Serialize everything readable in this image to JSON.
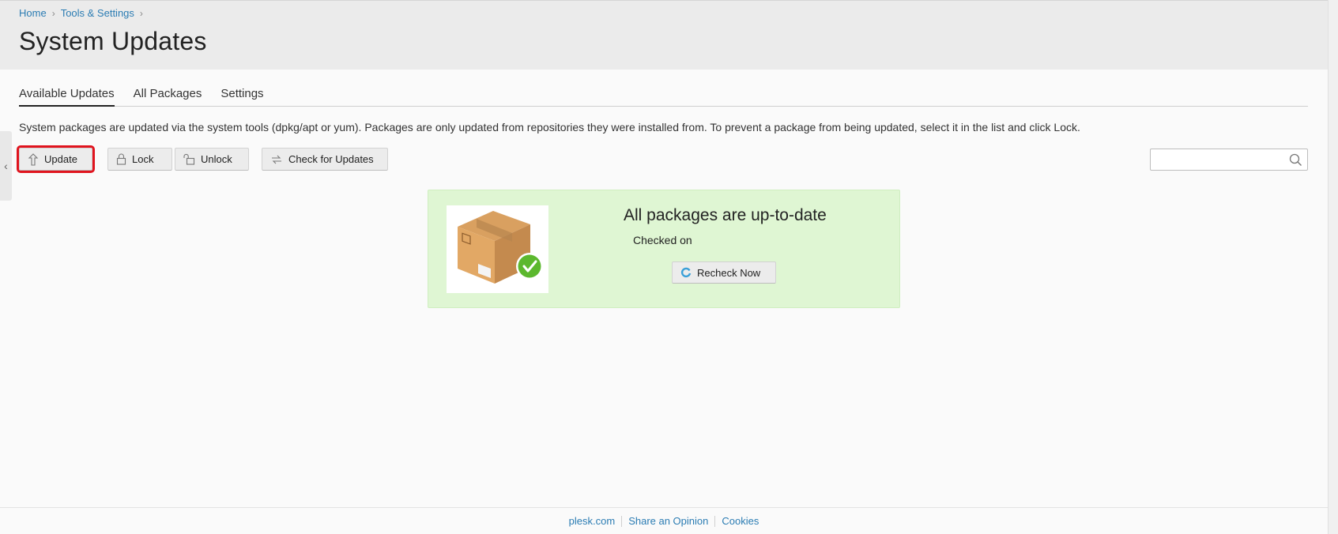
{
  "breadcrumb": {
    "items": [
      "Home",
      "Tools & Settings"
    ]
  },
  "page": {
    "title": "System Updates"
  },
  "tabs": [
    {
      "label": "Available Updates",
      "active": true
    },
    {
      "label": "All Packages",
      "active": false
    },
    {
      "label": "Settings",
      "active": false
    }
  ],
  "description": "System packages are updated via the system tools (dpkg/apt or yum). Packages are only updated from repositories they were installed from. To prevent a package from being updated, select it in the list and click Lock.",
  "toolbar": {
    "update_label": "Update",
    "lock_label": "Lock",
    "unlock_label": "Unlock",
    "check_label": "Check for Updates"
  },
  "search": {
    "placeholder": ""
  },
  "status": {
    "title": "All packages are up-to-date",
    "checked_label": "Checked on",
    "recheck_label": "Recheck Now"
  },
  "footer": {
    "links": [
      "plesk.com",
      "Share an Opinion",
      "Cookies"
    ]
  },
  "colors": {
    "accent_link": "#2b7cb3",
    "highlight": "#e0141e",
    "success_bg": "#dff6d3",
    "check_green": "#5cb82e"
  }
}
